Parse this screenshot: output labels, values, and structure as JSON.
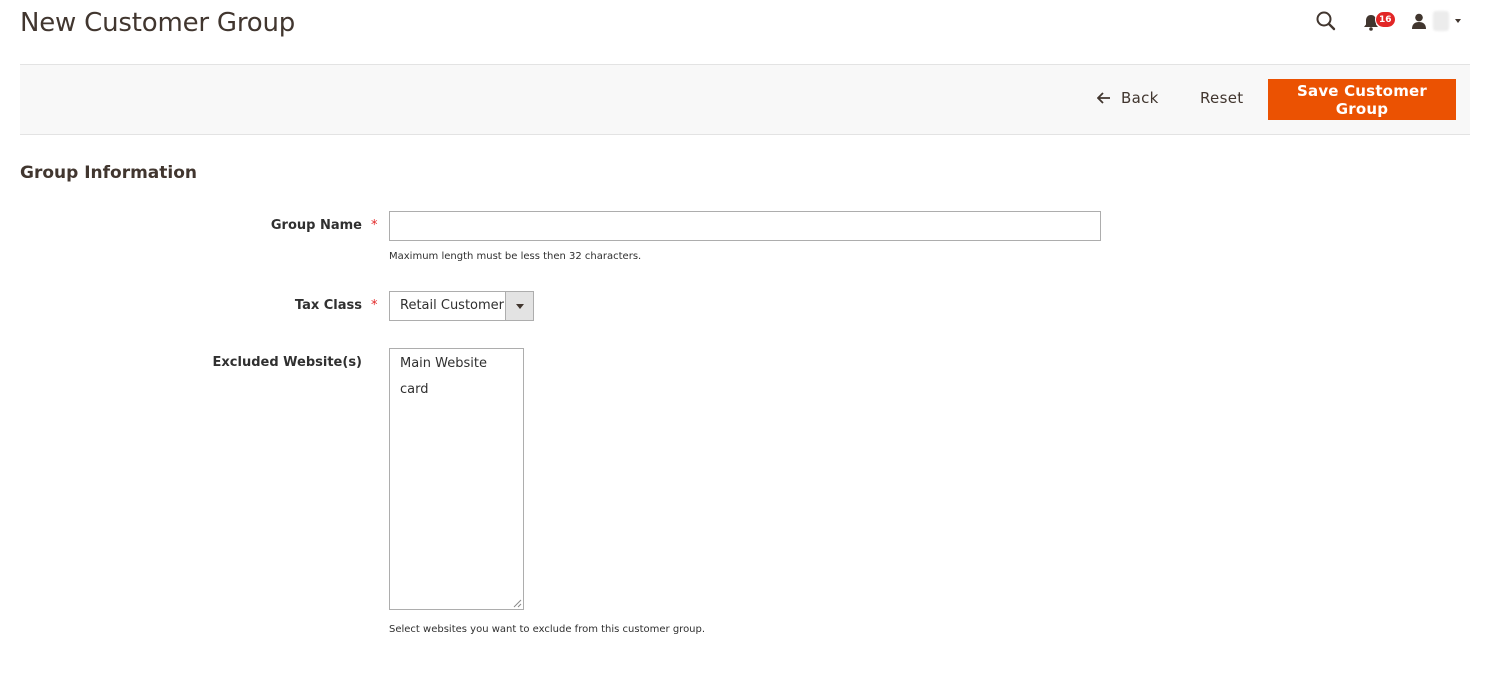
{
  "page": {
    "title": "New Customer Group"
  },
  "header": {
    "notifications_count": "16",
    "icons": [
      "search-icon",
      "bell-icon",
      "user-icon"
    ]
  },
  "action_bar": {
    "back_label": "Back",
    "reset_label": "Reset",
    "save_label": "Save Customer Group"
  },
  "form": {
    "section_title": "Group Information",
    "group_name": {
      "label": "Group Name",
      "required": "*",
      "value": "",
      "note": "Maximum length must be less then 32 characters."
    },
    "tax_class": {
      "label": "Tax Class",
      "required": "*",
      "selected": "Retail Customer"
    },
    "excluded_websites": {
      "label": "Excluded Website(s)",
      "options": [
        "Main Website",
        "card"
      ],
      "note": "Select websites you want to exclude from this customer group."
    }
  },
  "colors": {
    "accent": "#eb5202",
    "required": "#e22626",
    "badge": "#e22626",
    "toolbar_bg": "#f8f8f8"
  }
}
